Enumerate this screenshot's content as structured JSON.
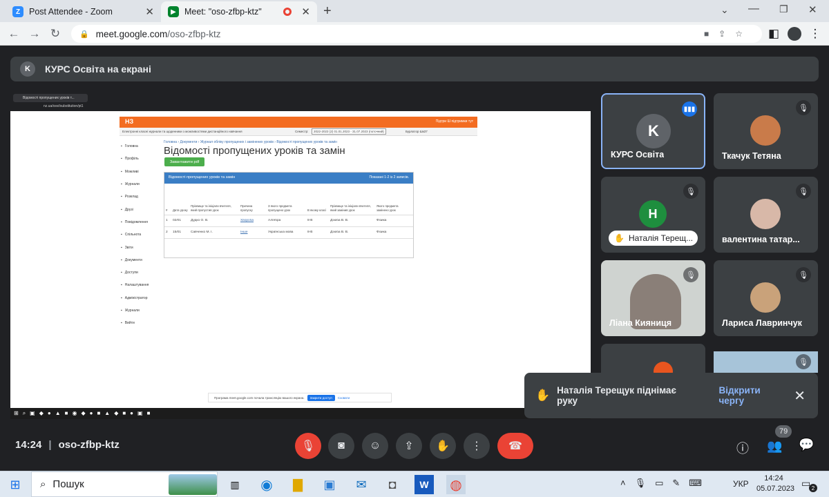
{
  "browser": {
    "tabs": [
      {
        "title": "Post Attendee - Zoom"
      },
      {
        "title": "Meet: \"oso-zfbp-ktz\""
      }
    ],
    "url_host": "meet.google.com",
    "url_path": "/oso-zfbp-ktz"
  },
  "meet": {
    "presenter_initial": "K",
    "presenting_banner": "КУРС Освіта на екрані",
    "time": "14:24",
    "separator": "|",
    "meeting_code": "oso-zfbp-ktz",
    "participants_count": "79",
    "participants": [
      {
        "name": "КУРС Освіта",
        "initial": "K",
        "color": "#5f6368"
      },
      {
        "name": "Ткачук Тетяна"
      },
      {
        "name": "Наталія Терещ...",
        "initial": "Н",
        "color": "#1e8e3e"
      },
      {
        "name": "валентина татар..."
      },
      {
        "name": "Ліана Кияниця"
      },
      {
        "name": "Лариса Лавринчук"
      }
    ],
    "toast": {
      "text": "Наталія Терещук піднімає руку",
      "action": "Відкрити чергу"
    }
  },
  "shared": {
    "tab_title": "Відомості пропущених уроків т...",
    "url": "nz.ua/osvi/substitution/pt1",
    "brand": "НЗ",
    "top_right": "Підтри Ш підтримки тут",
    "sub_header": "Електронні класні журнали та щоденники з можливостями дистанційного навчання",
    "semester_label": "Семестр:",
    "semester_value": "2022-2023 (2) 01.01.2023 - 31.07.2023 (поточний)",
    "user": "Бурлатор Шк37",
    "breadcrumb": "Головна › Документи › Журнал обліку пропущених і замінених уроків › Відомості пропущених уроків та замін",
    "title": "Відомості пропущених уроків та замін",
    "pdf_button": "Завантажити pdf",
    "panel_title": "Відомості пропущених уроків та замін",
    "panel_count": "Показані 1-2 із 2 записів.",
    "sidebar": [
      "Головна",
      "Профіль",
      "Можливі",
      "Журнали",
      "Розклад",
      "Друзі",
      "Повідомлення",
      "Спільнота",
      "Звіти",
      "Документи",
      "Доступи",
      "Налаштування",
      "Адміністратор",
      "Журнали",
      "Вийти"
    ],
    "columns": [
      "#",
      "Дата уроку",
      "Прізвище та ініціали вчителя, який пропустив урок",
      "Причина пропуску",
      "З якого предмета пропущено урок",
      "В якому класі",
      "Прізвище та ініціали вчителя, який замінив урок",
      "Якого предмета замінено урок"
    ],
    "rows": [
      [
        "1",
        "02/01",
        "Дудко О. В.",
        "Хвороба",
        "Алгебра",
        "8-В",
        "Дзюба В. В.",
        "Фізика"
      ],
      [
        "2",
        "15/01",
        "Савченко М. І.",
        "Інше",
        "Українська мова",
        "8-В",
        "Дзюба В. В.",
        "Фізика"
      ]
    ],
    "share_notice": "Програма meet.google.com почала трансляцію вашого екрана.",
    "share_stop": "Закрити доступ",
    "share_hide": "Сховати"
  },
  "taskbar": {
    "search": "Пошук",
    "lang": "УКР",
    "time": "14:24",
    "date": "05.07.2023",
    "notifications": "2"
  }
}
